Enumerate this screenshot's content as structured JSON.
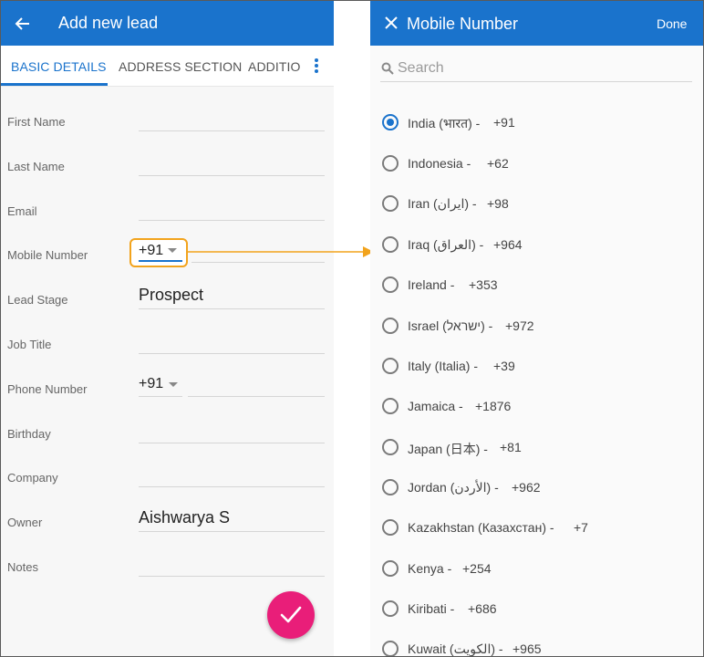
{
  "left": {
    "title": "Add new lead",
    "tabs": [
      "BASIC DETAILS",
      "ADDRESS SECTION",
      "ADDITIONAL"
    ],
    "fields": [
      {
        "label": "First Name",
        "value": ""
      },
      {
        "label": "Last Name",
        "value": ""
      },
      {
        "label": "Email",
        "value": ""
      },
      {
        "label": "Mobile Number",
        "value": "+91"
      },
      {
        "label": "Lead Stage",
        "value": "Prospect"
      },
      {
        "label": "Job Title",
        "value": ""
      },
      {
        "label": "Phone Number",
        "value": "+91"
      },
      {
        "label": "Birthday",
        "value": ""
      },
      {
        "label": "Company",
        "value": ""
      },
      {
        "label": "Owner",
        "value": "Aishwarya S"
      },
      {
        "label": "Notes",
        "value": ""
      }
    ]
  },
  "right": {
    "title": "Mobile Number",
    "done": "Done",
    "search_placeholder": "Search",
    "countries": [
      {
        "name": "India (भारत) -",
        "code": "+91",
        "selected": true
      },
      {
        "name": "Indonesia -",
        "code": "+62",
        "selected": false
      },
      {
        "name": "Iran (ایران) -",
        "code": "+98",
        "selected": false
      },
      {
        "name": "Iraq (العراق) -",
        "code": "+964",
        "selected": false
      },
      {
        "name": "Ireland -",
        "code": "+353",
        "selected": false
      },
      {
        "name": "Israel (ישראל) -",
        "code": "+972",
        "selected": false
      },
      {
        "name": "Italy (Italia) -",
        "code": "+39",
        "selected": false
      },
      {
        "name": "Jamaica -",
        "code": "+1876",
        "selected": false
      },
      {
        "name": "Japan (日本) -",
        "code": "+81",
        "selected": false
      },
      {
        "name": "Jordan (الأردن) -",
        "code": "+962",
        "selected": false
      },
      {
        "name": "Kazakhstan (Казахстан) -",
        "code": "+7",
        "selected": false
      },
      {
        "name": "Kenya -",
        "code": "+254",
        "selected": false
      },
      {
        "name": "Kiribati -",
        "code": "+686",
        "selected": false
      },
      {
        "name": "Kuwait (الكويت) -",
        "code": "+965",
        "selected": false
      }
    ]
  },
  "colors": {
    "primary": "#1a73cc",
    "highlight": "#f2a31c",
    "fab": "#e91e79"
  }
}
